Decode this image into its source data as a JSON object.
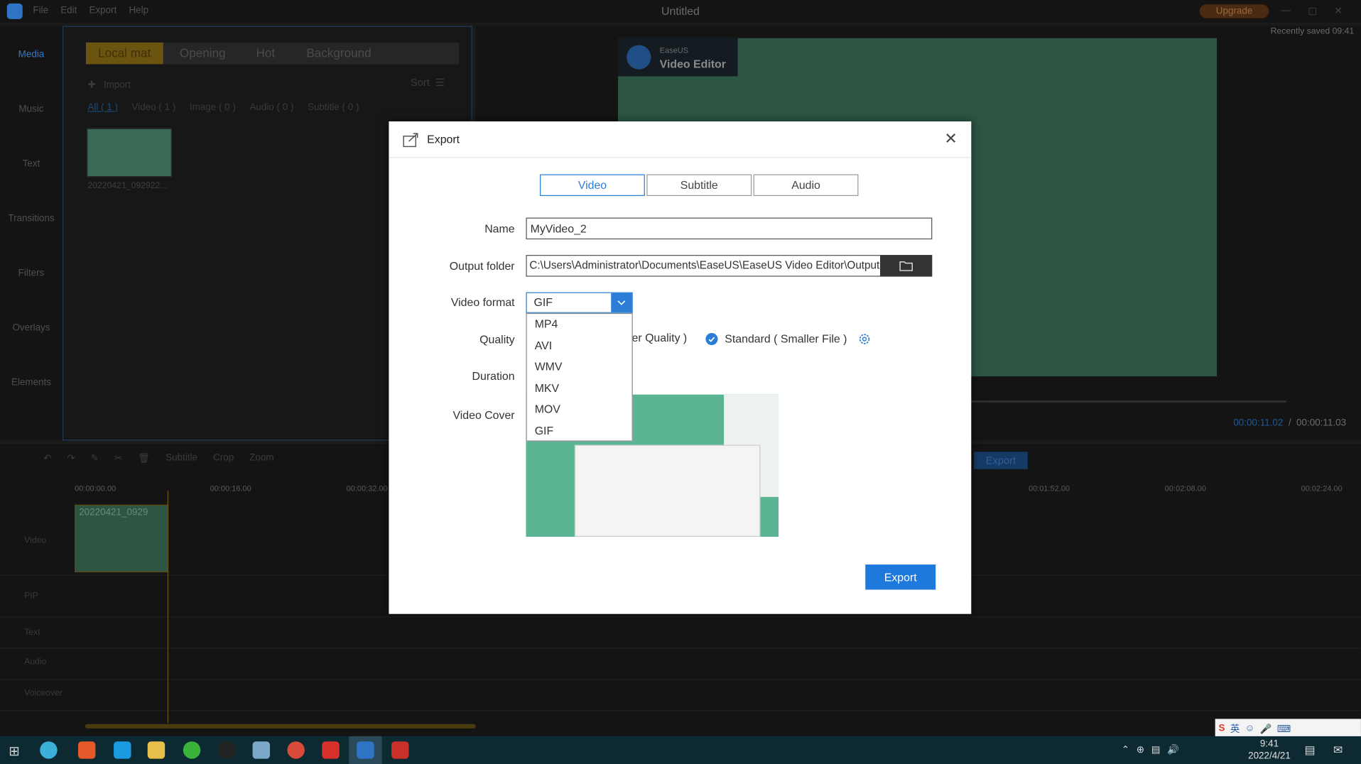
{
  "titlebar": {
    "menu": [
      "File",
      "Edit",
      "Export",
      "Help"
    ],
    "title": "Untitled",
    "upgrade": "Upgrade"
  },
  "sidebar": {
    "items": [
      "Media",
      "Music",
      "Text",
      "Transitions",
      "Filters",
      "Overlays",
      "Elements"
    ]
  },
  "media": {
    "tabs": [
      "Local mat",
      "Opening",
      "Hot",
      "Background"
    ],
    "import": "Import",
    "sort": "Sort",
    "filters": [
      "All ( 1 )",
      "Video ( 1 )",
      "Image ( 0 )",
      "Audio ( 0 )",
      "Subtitle ( 0 )"
    ],
    "thumb_name": "20220421_092922..."
  },
  "preview": {
    "saved": "Recently saved 09:41",
    "brand_top": "EaseUS",
    "brand_bottom": "Video Editor",
    "time_current": "00:00:11.02",
    "time_sep": "/",
    "time_total": "00:00:11.03"
  },
  "timeline": {
    "tools": [
      "Subtitle",
      "Crop",
      "Zoom"
    ],
    "export": "Export",
    "ruler": [
      "00:00:00.00",
      "00:00:16.00",
      "00:00:32.00",
      "00:01:52.00",
      "00:02:08.00",
      "00:02:24.00"
    ],
    "tracks": [
      "Video",
      "PIP",
      "Text",
      "Audio",
      "Voiceover"
    ],
    "clip_label": "20220421_0929"
  },
  "taskbar": {
    "time": "9:41",
    "date": "2022/4/21",
    "ime_lang": "英"
  },
  "dialog": {
    "title": "Export",
    "tabs": [
      "Video",
      "Subtitle",
      "Audio"
    ],
    "active_tab": "Video",
    "labels": {
      "name": "Name",
      "output_folder": "Output folder",
      "video_format": "Video format",
      "quality": "Quality",
      "duration": "Duration",
      "video_cover": "Video Cover"
    },
    "name_value": "MyVideo_2",
    "output_folder_value": "C:\\Users\\Administrator\\Documents\\EaseUS\\EaseUS Video Editor\\Output",
    "format_value": "GIF",
    "format_options": [
      "MP4",
      "AVI",
      "WMV",
      "MKV",
      "MOV",
      "GIF"
    ],
    "quality_high_partial": "er Quality )",
    "quality_standard": "Standard ( Smaller File )",
    "export_button": "Export"
  },
  "colors": {
    "accent": "#2b7dd6",
    "export_button": "#1f78dc"
  }
}
